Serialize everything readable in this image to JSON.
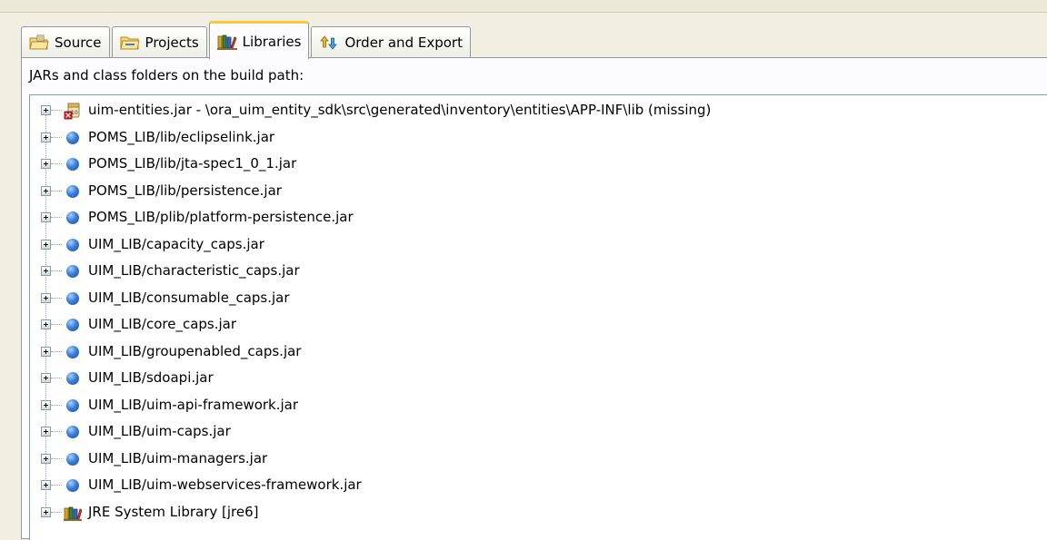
{
  "tabs": [
    {
      "label": "Source",
      "icon": "source-folder-icon",
      "active": false
    },
    {
      "label": "Projects",
      "icon": "projects-folder-icon",
      "active": false
    },
    {
      "label": "Libraries",
      "icon": "libraries-icon",
      "active": true
    },
    {
      "label": "Order and Export",
      "icon": "order-export-icon",
      "active": false
    }
  ],
  "panel": {
    "label": "JARs and class folders on the build path:"
  },
  "tree": {
    "items": [
      {
        "label": "uim-entities.jar - \\ora_uim_entity_sdk\\src\\generated\\inventory\\entities\\APP-INF\\lib (missing)",
        "icon": "missing-jar-icon"
      },
      {
        "label": "POMS_LIB/lib/eclipselink.jar",
        "icon": "variable-jar-icon"
      },
      {
        "label": "POMS_LIB/lib/jta-spec1_0_1.jar",
        "icon": "variable-jar-icon"
      },
      {
        "label": "POMS_LIB/lib/persistence.jar",
        "icon": "variable-jar-icon"
      },
      {
        "label": "POMS_LIB/plib/platform-persistence.jar",
        "icon": "variable-jar-icon"
      },
      {
        "label": "UIM_LIB/capacity_caps.jar",
        "icon": "variable-jar-icon"
      },
      {
        "label": "UIM_LIB/characteristic_caps.jar",
        "icon": "variable-jar-icon"
      },
      {
        "label": "UIM_LIB/consumable_caps.jar",
        "icon": "variable-jar-icon"
      },
      {
        "label": "UIM_LIB/core_caps.jar",
        "icon": "variable-jar-icon"
      },
      {
        "label": "UIM_LIB/groupenabled_caps.jar",
        "icon": "variable-jar-icon"
      },
      {
        "label": "UIM_LIB/sdoapi.jar",
        "icon": "variable-jar-icon"
      },
      {
        "label": "UIM_LIB/uim-api-framework.jar",
        "icon": "variable-jar-icon"
      },
      {
        "label": "UIM_LIB/uim-caps.jar",
        "icon": "variable-jar-icon"
      },
      {
        "label": "UIM_LIB/uim-managers.jar",
        "icon": "variable-jar-icon"
      },
      {
        "label": "UIM_LIB/uim-webservices-framework.jar",
        "icon": "variable-jar-icon"
      },
      {
        "label": "JRE System Library [jre6]",
        "icon": "library-icon"
      }
    ]
  },
  "colors": {
    "active_tab_accent": "#ffc83c",
    "variable_ball": "#3a7fd8",
    "missing_marker": "#d42020"
  }
}
